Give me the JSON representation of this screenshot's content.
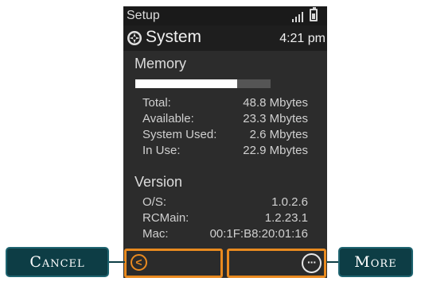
{
  "status_bar": {
    "title": "Setup",
    "signal_icon": "signal-icon",
    "battery_icon": "battery-icon"
  },
  "header": {
    "title": "System",
    "time": "4:21 pm",
    "icon": "settings-icon"
  },
  "memory": {
    "title": "Memory",
    "usage_fraction": 0.75,
    "rows": [
      {
        "label": "Total:",
        "value": "48.8 Mbytes"
      },
      {
        "label": "Available:",
        "value": "23.3 Mbytes"
      },
      {
        "label": "System Used:",
        "value": "2.6 Mbytes"
      },
      {
        "label": "In Use:",
        "value": "22.9 Mbytes"
      }
    ]
  },
  "version": {
    "title": "Version",
    "rows": [
      {
        "label": "O/S:",
        "value": "1.0.2.6"
      },
      {
        "label": "RCMain:",
        "value": "1.2.23.1"
      },
      {
        "label": "Mac:",
        "value": "00:1F:B8:20:01:16"
      }
    ]
  },
  "softkeys": {
    "left_icon": "back-chevron-icon",
    "left_glyph": "<",
    "right_icon": "more-ellipsis-icon",
    "right_glyph": "···"
  },
  "callouts": {
    "cancel": "Cancel",
    "more": "More"
  },
  "colors": {
    "accent": "#e98a1f",
    "callout_bg": "#0d3d45",
    "screen_bg": "#2c2c2c"
  }
}
